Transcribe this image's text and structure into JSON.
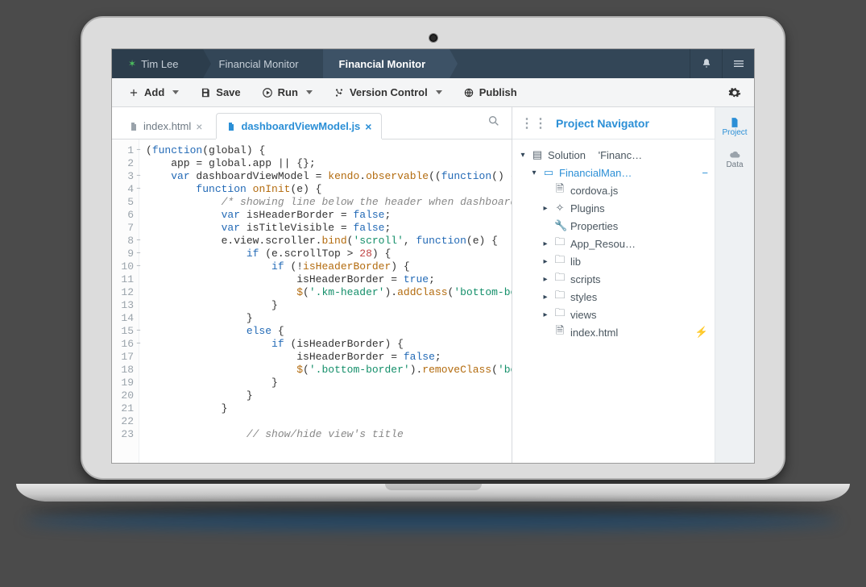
{
  "breadcrumb": {
    "user": "Tim Lee",
    "project": "Financial Monitor",
    "app": "Financial Monitor"
  },
  "toolbar": {
    "add": "Add",
    "save": "Save",
    "run": "Run",
    "vc": "Version Control",
    "publish": "Publish"
  },
  "tabs": [
    {
      "label": "index.html"
    },
    {
      "label": "dashboardViewModel.js"
    }
  ],
  "navigator": {
    "title": "Project Navigator",
    "solution_prefix": "Solution",
    "solution_name": "'Financ…",
    "project_name": "FinancialMan…",
    "items": [
      {
        "label": "cordova.js",
        "type": "file"
      },
      {
        "label": "Plugins",
        "type": "plugins"
      },
      {
        "label": "Properties",
        "type": "properties"
      },
      {
        "label": "App_Resou…",
        "type": "folder"
      },
      {
        "label": "lib",
        "type": "folder"
      },
      {
        "label": "scripts",
        "type": "folder"
      },
      {
        "label": "styles",
        "type": "folder"
      },
      {
        "label": "views",
        "type": "folder"
      },
      {
        "label": "index.html",
        "type": "file"
      }
    ]
  },
  "rail": {
    "project": "Project",
    "data": "Data"
  },
  "code": {
    "l1": "(function(global) {",
    "l2": "    app = global.app || {};",
    "l3": "    var dashboardViewModel = kendo.observable((function() {",
    "l4": "        function onInit(e) {",
    "l5": "            /* showing line below the header when dashboard is se",
    "l6": "            var isHeaderBorder = false;",
    "l7": "            var isTitleVisible = false;",
    "l8": "            e.view.scroller.bind('scroll', function(e) {",
    "l9": "                if (e.scrollTop > 28) {",
    "l10": "                    if (!isHeaderBorder) {",
    "l11": "                        isHeaderBorder = true;",
    "l12": "                        $('.km-header').addClass('bottom-border'",
    "l13": "                    }",
    "l14": "                }",
    "l15": "                else {",
    "l16": "                    if (isHeaderBorder) {",
    "l17": "                        isHeaderBorder = false;",
    "l18": "                        $('.bottom-border').removeClass('bottom-b",
    "l19": "                    }",
    "l20": "                }",
    "l21": "            }",
    "l22": "",
    "l23": "                // show/hide view's title"
  }
}
